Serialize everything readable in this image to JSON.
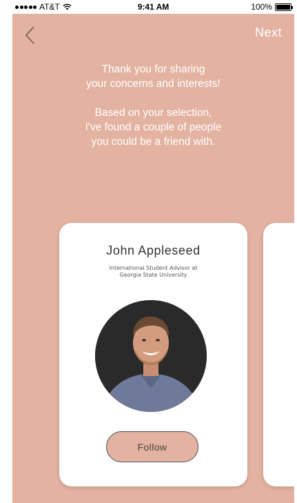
{
  "status_bar": {
    "carrier": "AT&T",
    "time": "9:41 AM",
    "battery": "100%",
    "wifi_icon": "wifi-icon",
    "battery_icon": "battery-icon"
  },
  "nav": {
    "back_icon": "chevron-left-icon",
    "next_label": "Next"
  },
  "message": {
    "line1": "Thank you for sharing",
    "line2": "your concerns and interests!",
    "line3": "Based on your selection,",
    "line4": "I've found a couple of people",
    "line5": "you could be a friend with."
  },
  "cards": [
    {
      "name": "John Appleseed",
      "role_line1": "International Student Advisor at",
      "role_line2": "Georgia State University",
      "follow_label": "Follow"
    }
  ],
  "colors": {
    "background": "#e3b2a1",
    "card": "#ffffff",
    "text_on_bg": "#ffffff"
  }
}
